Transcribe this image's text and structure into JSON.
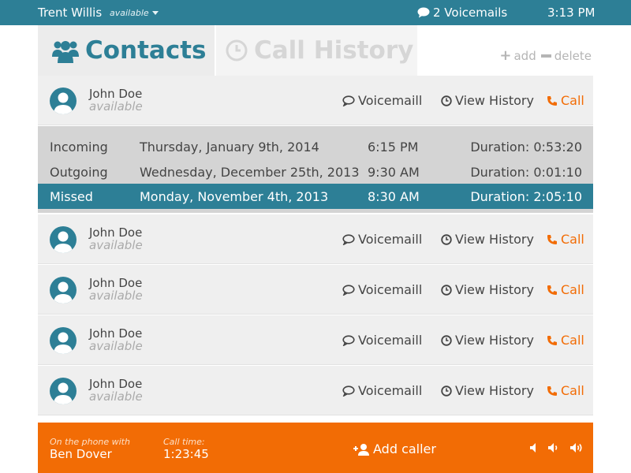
{
  "topbar": {
    "user_name": "Trent Willis",
    "status": "available",
    "voicemails": "2 Voicemails",
    "clock": "3:13 PM"
  },
  "tabs": [
    {
      "label": "Contacts",
      "icon": "users-icon",
      "active": true
    },
    {
      "label": "Call History",
      "icon": "clock-icon",
      "active": false
    }
  ],
  "toolbar": {
    "add_label": "add",
    "delete_label": "delete"
  },
  "contacts": [
    {
      "name": "John Doe",
      "status": "available",
      "voicemail_label": "Voicemaill",
      "history_label": "View History",
      "call_label": "Call"
    },
    {
      "name": "John Doe",
      "status": "available",
      "voicemail_label": "Voicemaill",
      "history_label": "View History",
      "call_label": "Call"
    },
    {
      "name": "John Doe",
      "status": "available",
      "voicemail_label": "Voicemaill",
      "history_label": "View History",
      "call_label": "Call"
    },
    {
      "name": "John Doe",
      "status": "available",
      "voicemail_label": "Voicemaill",
      "history_label": "View History",
      "call_label": "Call"
    },
    {
      "name": "John Doe",
      "status": "available",
      "voicemail_label": "Voicemaill",
      "history_label": "View History",
      "call_label": "Call"
    }
  ],
  "history": [
    {
      "type": "Incoming",
      "date": "Thursday, January 9th, 2014",
      "time": "6:15 PM",
      "duration": "Duration: 0:53:20"
    },
    {
      "type": "Outgoing",
      "date": "Wednesday, December 25th, 2013",
      "time": "9:30 AM",
      "duration": "Duration: 0:01:10"
    },
    {
      "type": "Missed",
      "date": "Monday, November 4th, 2013",
      "time": "8:30 AM",
      "duration": "Duration: 2:05:10"
    }
  ],
  "callbar": {
    "on_phone_label": "On the phone with",
    "caller": "Ben Dover",
    "call_time_label": "Call time:",
    "call_time": "1:23:45",
    "add_caller_label": "Add caller"
  },
  "colors": {
    "primary": "#2d7f96",
    "accent": "#f26c05",
    "row_bg": "#efefef",
    "history_bg": "#d4d4d4"
  }
}
